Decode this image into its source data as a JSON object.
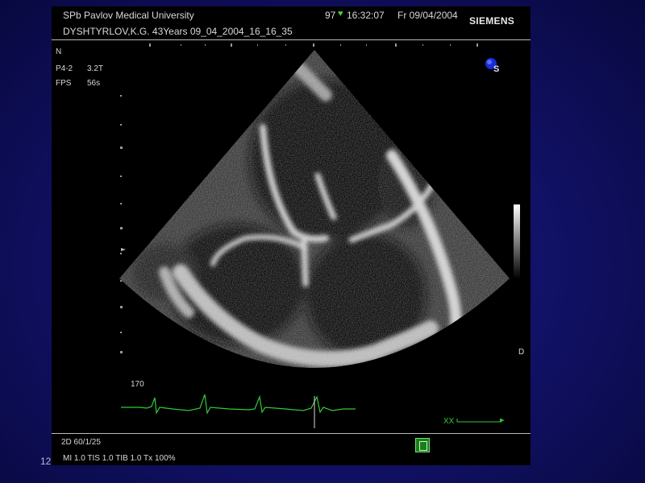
{
  "header": {
    "institution": "SPb Pavlov Medical University",
    "patient_line": "DYSHTYRLOV,K.G. 43Years 09_04_2004_16_16_35",
    "heart_rate": "97",
    "time": "16:32:07",
    "date": "Fr 09/04/2004",
    "brand": "SIEMENS"
  },
  "params": {
    "orientation": "N",
    "probe": "P4-2",
    "frequency": "3.2T",
    "fps_label": "FPS",
    "fps_value": "56s"
  },
  "right_markers": {
    "depth_marker": "D",
    "logo_letter": "S"
  },
  "ecg": {
    "scale_value": "170",
    "label": "XX"
  },
  "footer": {
    "mode": "2D 60/1/25",
    "indices": "MI 1.0   TIS 1.0   TIB 1.0   Tx   100%"
  },
  "slide_number": "12",
  "colors": {
    "ecg_trace": "#35c83a",
    "heart_icon": "#3fd23f",
    "background_blue": "#12126a"
  }
}
